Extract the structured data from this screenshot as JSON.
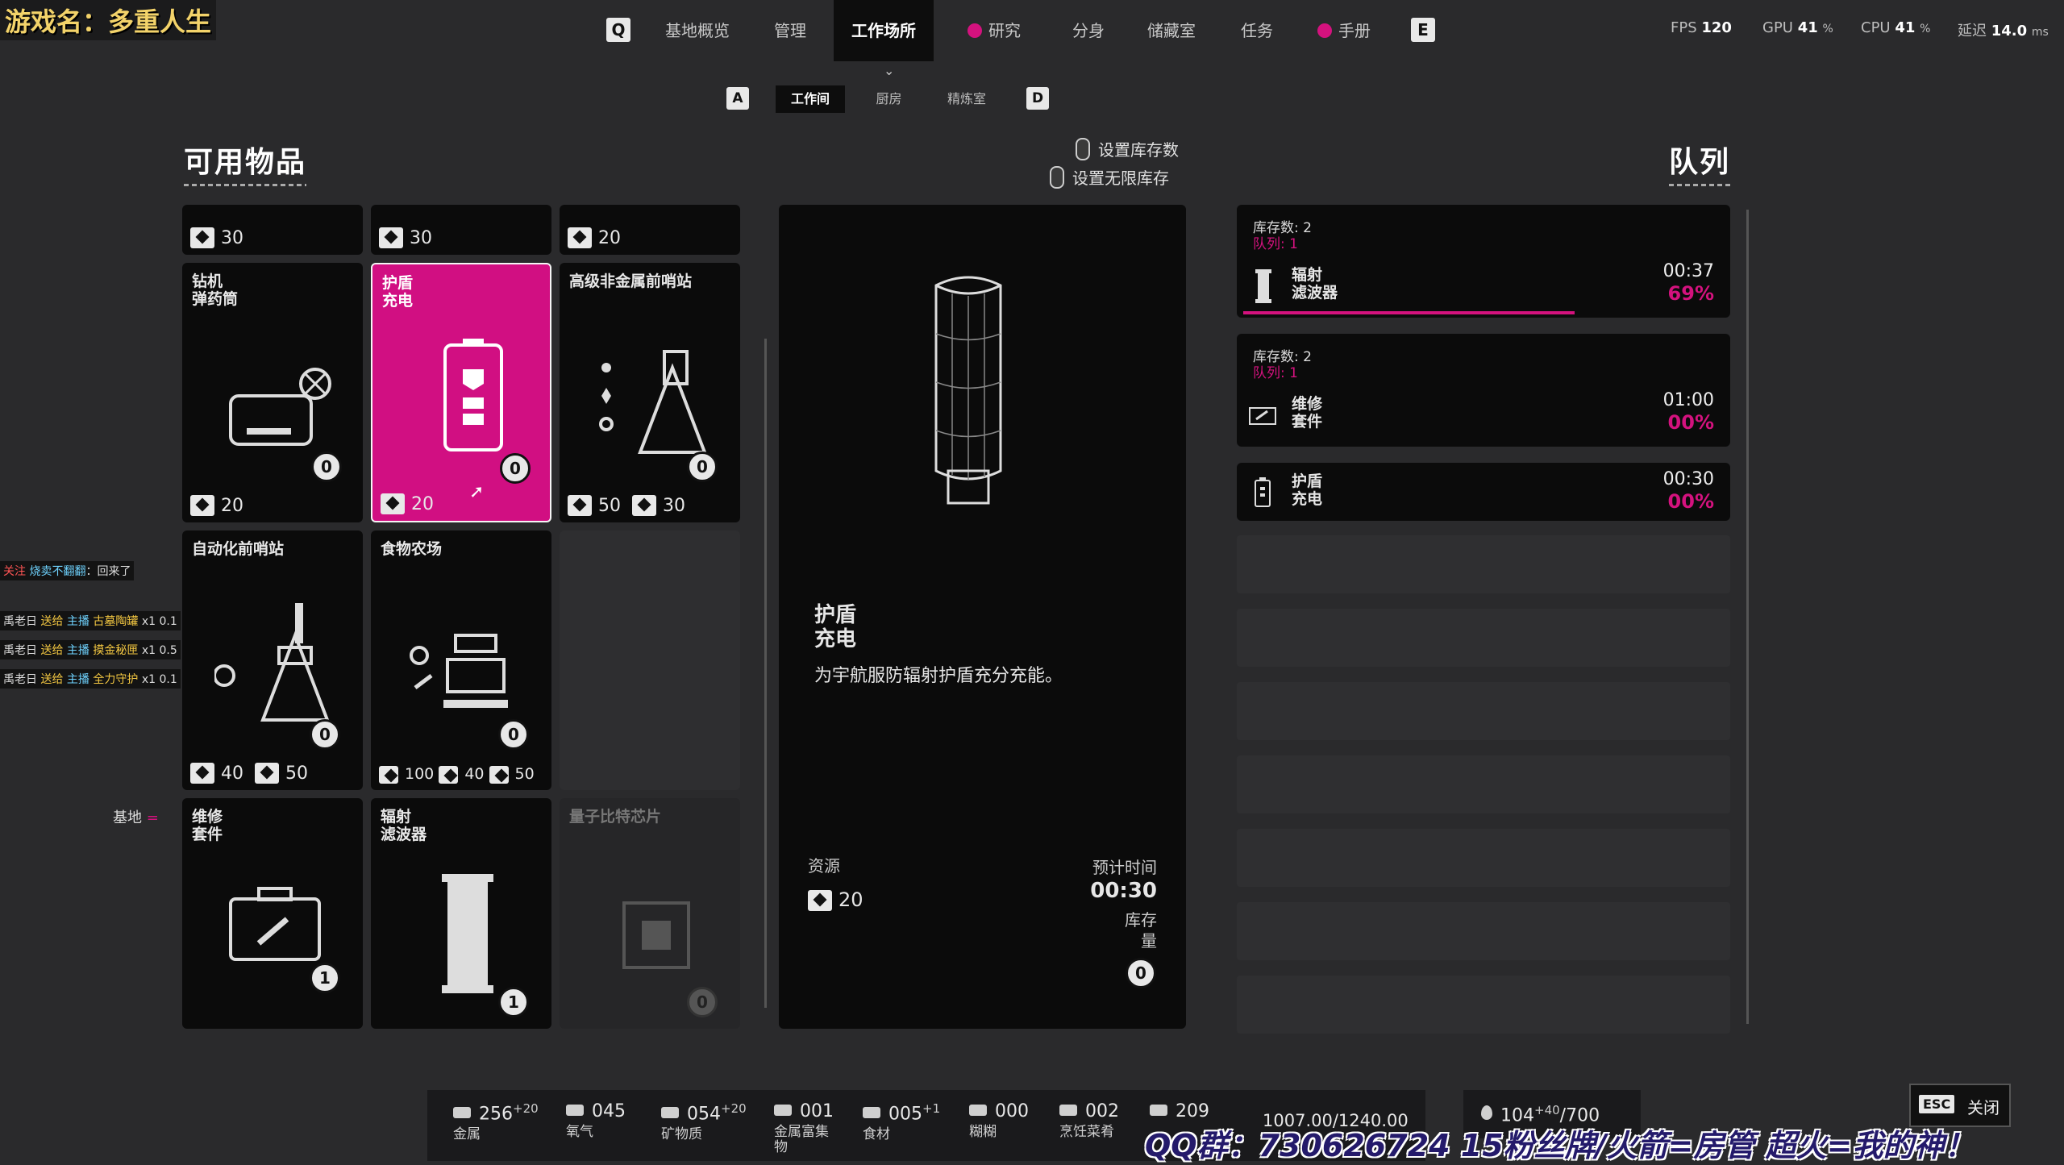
{
  "overlay": {
    "game_name": "游戏名：多重人生",
    "bottom_text": "QQ群：730626724 15粉丝牌/火箭=房管 超火=我的神！"
  },
  "nav": {
    "left_key": "Q",
    "right_key": "E",
    "items": [
      "基地概览",
      "管理",
      "工作场所",
      "研究",
      "分身",
      "储藏室",
      "任务",
      "手册"
    ],
    "active": "工作场所"
  },
  "perf": {
    "fps_label": "FPS",
    "fps": "120",
    "gpu_label": "GPU",
    "gpu": "41",
    "cpu_label": "CPU",
    "cpu": "41",
    "pct": "%",
    "latency_label": "延迟",
    "latency": "14.0",
    "latency_unit": "ms"
  },
  "subtabs": {
    "left_key": "A",
    "right_key": "D",
    "items": [
      "工作间",
      "厨房",
      "精炼室"
    ],
    "active": "工作间"
  },
  "available": {
    "title": "可用物品",
    "hint_set_stock": "设置库存数",
    "hint_unlimited": "设置无限库存",
    "top_row_costs": [
      "30",
      "30",
      "20"
    ],
    "cards": [
      {
        "name": "钻机\n弹药筒",
        "badge": "0",
        "costs": [
          "20"
        ]
      },
      {
        "name": "护盾\n充电",
        "badge": "0",
        "costs": [
          "20"
        ]
      },
      {
        "name": "高级非金属前哨站",
        "badge": "0",
        "costs": [
          "50",
          "30"
        ]
      },
      {
        "name": "自动化前哨站",
        "badge": "0",
        "costs": [
          "40",
          "50"
        ]
      },
      {
        "name": "食物农场",
        "badge": "0",
        "costs": [
          "100",
          "40",
          "50"
        ]
      },
      {
        "name": "",
        "badge": "",
        "costs": []
      },
      {
        "name": "维修\n套件",
        "badge": "1",
        "costs": []
      },
      {
        "name": "辐射\n滤波器",
        "badge": "1",
        "costs": []
      },
      {
        "name": "量子比特芯片",
        "badge": "0",
        "costs": []
      }
    ]
  },
  "base_label": "基地",
  "detail": {
    "name": "护盾\n充电",
    "description": "为宇航服防辐射护盾充分充能。",
    "resources_label": "资源",
    "resource_value": "20",
    "time_label": "预计时间",
    "time_value": "00:30",
    "stock_label": "库存\n量",
    "stock_value": "0"
  },
  "queue": {
    "title": "队列",
    "entries": [
      {
        "stock": "库存数: 2",
        "queue": "队列: 1",
        "name": "辐射\n滤波器",
        "time": "00:37",
        "pct": "69%",
        "progress": 0.69
      },
      {
        "stock": "库存数: 2",
        "queue": "队列: 1",
        "name": "维修\n套件",
        "time": "01:00",
        "pct": "00%",
        "progress": 0
      },
      {
        "stock": "",
        "queue": "",
        "name": "护盾\n充电",
        "time": "00:30",
        "pct": "00%",
        "progress": 0
      }
    ]
  },
  "chat": {
    "header_tag": "关注",
    "header_user": "烧卖不翻翻",
    "header_msg": "回来了",
    "lines": [
      {
        "user": "禹老日",
        "action": "送给",
        "target": "主播",
        "gift": "古墓陶罐",
        "count": "x1",
        "val": "0.1"
      },
      {
        "user": "禹老日",
        "action": "送给",
        "target": "主播",
        "gift": "摸金秘匣",
        "count": "x1",
        "val": "0.5"
      },
      {
        "user": "禹老日",
        "action": "送给",
        "target": "主播",
        "gift": "全力守护",
        "count": "x1",
        "val": "0.1"
      }
    ]
  },
  "resources": [
    {
      "value": "256",
      "delta": "+20",
      "label": "金属"
    },
    {
      "value": "045",
      "delta": "",
      "label": "氧气"
    },
    {
      "value": "054",
      "delta": "+20",
      "label": "矿物质"
    },
    {
      "value": "001",
      "delta": "",
      "label": "金属富集物"
    },
    {
      "value": "005",
      "delta": "+1",
      "label": "食材"
    },
    {
      "value": "000",
      "delta": "",
      "label": "糊糊"
    },
    {
      "value": "002",
      "delta": "",
      "label": "烹饪菜肴"
    },
    {
      "value": "209",
      "delta": "",
      "label": ""
    }
  ],
  "capacity": "1007.00/1240.00",
  "water": {
    "value": "104",
    "delta": "+40",
    "max": "/700"
  },
  "esc": {
    "key": "ESC",
    "label": "关闭"
  }
}
